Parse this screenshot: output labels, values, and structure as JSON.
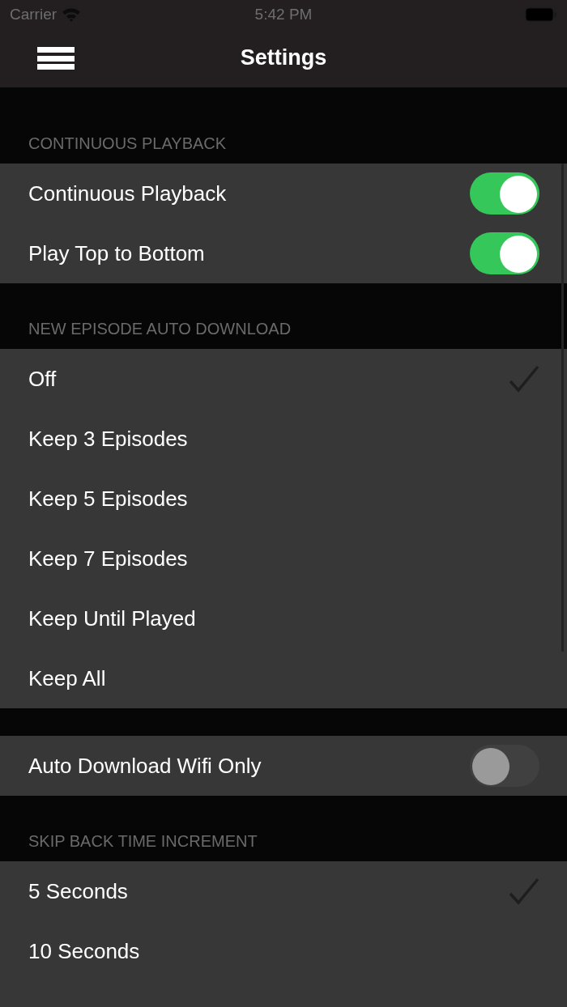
{
  "status_bar": {
    "carrier": "Carrier",
    "time": "5:42 PM"
  },
  "nav": {
    "title": "Settings"
  },
  "sections": [
    {
      "header": "CONTINUOUS PLAYBACK",
      "rows": [
        {
          "kind": "toggle",
          "label": "Continuous Playback",
          "on": true
        },
        {
          "kind": "toggle",
          "label": "Play Top to Bottom",
          "on": true
        }
      ]
    },
    {
      "header": "NEW EPISODE AUTO DOWNLOAD",
      "rows": [
        {
          "kind": "choice",
          "label": "Off",
          "selected": true
        },
        {
          "kind": "choice",
          "label": "Keep 3 Episodes",
          "selected": false
        },
        {
          "kind": "choice",
          "label": "Keep 5 Episodes",
          "selected": false
        },
        {
          "kind": "choice",
          "label": "Keep 7 Episodes",
          "selected": false
        },
        {
          "kind": "choice",
          "label": "Keep Until Played",
          "selected": false
        },
        {
          "kind": "choice",
          "label": "Keep All",
          "selected": false
        }
      ]
    },
    {
      "rows": [
        {
          "kind": "toggle",
          "label": "Auto Download Wifi Only",
          "on": false
        }
      ]
    },
    {
      "header": "SKIP BACK TIME INCREMENT",
      "rows": [
        {
          "kind": "choice",
          "label": "5 Seconds",
          "selected": true
        },
        {
          "kind": "choice",
          "label": "10 Seconds",
          "selected": false
        }
      ]
    }
  ]
}
